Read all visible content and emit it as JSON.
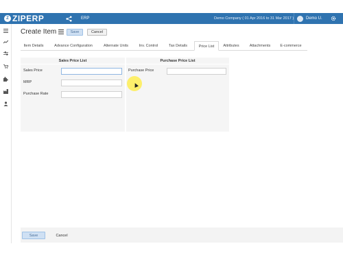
{
  "app": {
    "logo_text": "ZIPERP",
    "module": "ERP",
    "company": "Demo Company ( 01 Apr 2016 to 31 Mar 2017 )",
    "user": "Demo U."
  },
  "page": {
    "title": "Create Item",
    "save_label": "Save",
    "cancel_label": "Cancel"
  },
  "tabs": [
    {
      "label": "Item Details"
    },
    {
      "label": "Advance Configuration"
    },
    {
      "label": "Alternate Units"
    },
    {
      "label": "Inv. Control"
    },
    {
      "label": "Tax Details"
    },
    {
      "label": "Price List"
    },
    {
      "label": "Attributes"
    },
    {
      "label": "Attachments"
    },
    {
      "label": "E-commerce"
    }
  ],
  "active_tab": "Price List",
  "sales_price_list": {
    "title": "Sales Price List",
    "fields": [
      {
        "label": "Sales Price",
        "value": ""
      },
      {
        "label": "MRP",
        "value": ""
      },
      {
        "label": "Purchase Rate",
        "value": ""
      }
    ]
  },
  "purchase_price_list": {
    "title": "Purchase Price List",
    "fields": [
      {
        "label": "Purchase Price",
        "value": ""
      }
    ]
  },
  "footer": {
    "save_label": "Save",
    "cancel_label": "Cancel"
  },
  "colors": {
    "topbar": "#2f73b0",
    "save_button": "#cfe0f3",
    "panel_bg": "#f5f5f5"
  },
  "icons": {
    "sidebar": [
      "menu-icon",
      "chart-icon",
      "sliders-icon",
      "cart-icon",
      "puzzle-icon",
      "factory-icon",
      "person-icon"
    ]
  }
}
